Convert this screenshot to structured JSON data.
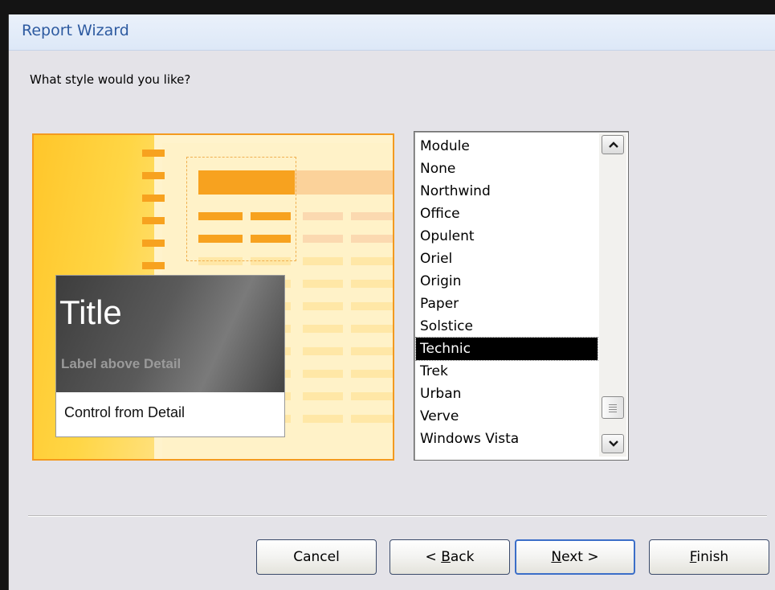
{
  "window": {
    "title": "Report Wizard"
  },
  "question": "What style would you like?",
  "preview": {
    "title": "Title",
    "label": "Label above Detail",
    "control": "Control from Detail"
  },
  "styles": {
    "items": [
      "Module",
      "None",
      "Northwind",
      "Office",
      "Opulent",
      "Oriel",
      "Origin",
      "Paper",
      "Solstice",
      "Technic",
      "Trek",
      "Urban",
      "Verve",
      "Windows Vista"
    ],
    "selected": "Technic"
  },
  "buttons": {
    "cancel": "Cancel",
    "back_prefix": "< ",
    "back_key": "B",
    "back_rest": "ack",
    "next_key": "N",
    "next_rest": "ext >",
    "finish_key": "F",
    "finish_rest": "inish"
  },
  "colors": {
    "title_text": "#2d5aa0",
    "accent_orange": "#f7a21f",
    "selection_bg": "#000000"
  }
}
